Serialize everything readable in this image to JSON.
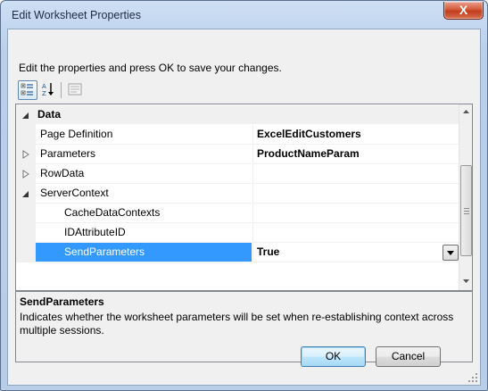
{
  "window": {
    "title": "Edit Worksheet Properties",
    "close_glyph": "X"
  },
  "instruction": "Edit the properties and press OK to save your changes.",
  "toolbar": {
    "categorized": "categorized-view-icon",
    "alphabetical": "alphabetical-sort-icon",
    "property_pages": "property-pages-icon"
  },
  "grid": {
    "rows": [
      {
        "kind": "category",
        "label": "Data",
        "expanded": true,
        "value": ""
      },
      {
        "kind": "property",
        "label": "Page Definition",
        "value": "ExcelEditCustomers"
      },
      {
        "kind": "property",
        "label": "Parameters",
        "value": "ProductNameParam",
        "expander": "collapsed"
      },
      {
        "kind": "property",
        "label": "RowData",
        "value": "",
        "expander": "collapsed"
      },
      {
        "kind": "property",
        "label": "ServerContext",
        "value": "",
        "expander": "expanded"
      },
      {
        "kind": "sub",
        "label": "CacheDataContexts",
        "value": ""
      },
      {
        "kind": "sub",
        "label": "IDAttributeID",
        "value": ""
      },
      {
        "kind": "sub",
        "label": "SendParameters",
        "value": "True",
        "selected": true
      }
    ]
  },
  "help": {
    "title": "SendParameters",
    "description": "Indicates whether the worksheet parameters will be set when re-establishing context across multiple sessions."
  },
  "buttons": {
    "ok": "OK",
    "cancel": "Cancel"
  },
  "colors": {
    "selection": "#3399ff",
    "title_bar": "#c2d6ef",
    "close_button": "#c23b1c"
  }
}
